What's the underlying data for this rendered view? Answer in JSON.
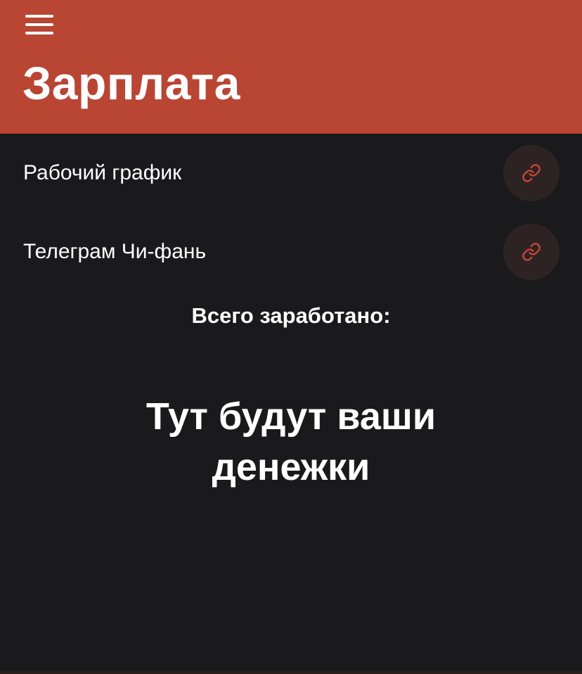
{
  "header": {
    "title": "Зарплата",
    "background_color": "#b94533"
  },
  "menu": {
    "icon": "hamburger-menu-icon"
  },
  "links": [
    {
      "label": "Рабочий график",
      "icon": "link-icon"
    },
    {
      "label": "Телеграм Чи-фань",
      "icon": "link-icon"
    }
  ],
  "summary": {
    "total_label": "Всего заработано:",
    "placeholder": "Тут будут ваши денежки"
  },
  "colors": {
    "background": "#1a1a1d",
    "accent": "#b94533",
    "link_icon": "#c9463a",
    "link_button_bg": "#2e2323"
  }
}
